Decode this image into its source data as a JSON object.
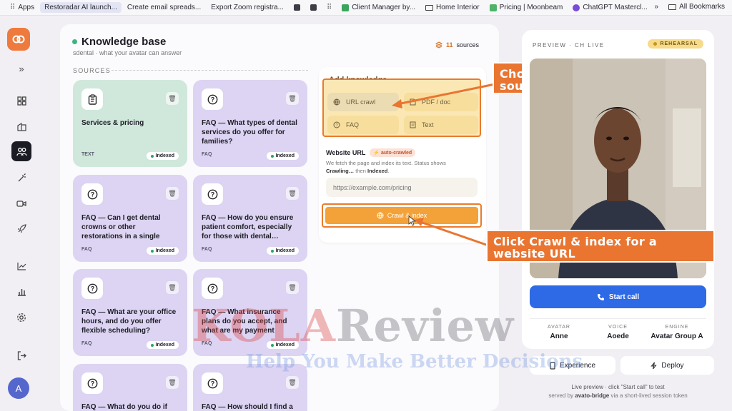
{
  "bookmarks_bar": {
    "items": [
      {
        "label": "Apps"
      },
      {
        "label": "Restoradar AI launch..."
      },
      {
        "label": "Create email spreads..."
      },
      {
        "label": "Export Zoom registra..."
      },
      {
        "label": "Client Manager by..."
      },
      {
        "label": "Home Interior"
      },
      {
        "label": "Pricing | Moonbeam"
      },
      {
        "label": "ChatGPT Mastercl..."
      }
    ],
    "overflow": "»",
    "all_bookmarks": "All Bookmarks"
  },
  "header": {
    "title": "Knowledge base",
    "subtitle": "sdental · what your avatar can answer",
    "sources_count": "11",
    "sources_label": "sources"
  },
  "sources_section_label": "SOURCES",
  "cards": [
    {
      "title": "Services & pricing",
      "type": "TEXT",
      "status": "Indexed"
    },
    {
      "title": "FAQ — What types of dental services do you offer for families?",
      "type": "FAQ",
      "status": "Indexed"
    },
    {
      "title": "FAQ — Can I get dental crowns or other restorations in a single visit?",
      "type": "FAQ",
      "status": "Indexed"
    },
    {
      "title": "FAQ — How do you ensure patient comfort, especially for those with dental…",
      "type": "FAQ",
      "status": "Indexed"
    },
    {
      "title": "FAQ — What are your office hours, and do you offer flexible scheduling?",
      "type": "FAQ",
      "status": "Indexed"
    },
    {
      "title": "FAQ — What insurance plans do you accept, and what are my payment options?",
      "type": "FAQ",
      "status": "Indexed"
    },
    {
      "title": "FAQ — What do you do if you",
      "type": "",
      "status": ""
    },
    {
      "title": "FAQ — How should I find a",
      "type": "",
      "status": ""
    }
  ],
  "add_knowledge": {
    "title": "Add knowledge",
    "options": [
      "URL crawl",
      "PDF / doc",
      "FAQ",
      "Text"
    ],
    "url_label": "Website URL",
    "url_tag": "auto-crawled",
    "help_text": "We fetch the page and index its text. Status shows",
    "help_crawling": "Crawling…",
    "help_then": "then",
    "help_indexed": "Indexed",
    "help_end": ".",
    "url_placeholder": "https://example.com/pricing",
    "crawl_button": "Crawl & index"
  },
  "callouts": {
    "choose_source": "Choose a knowledge source",
    "click_crawl": "Click Crawl & index for a website URL"
  },
  "preview": {
    "header": "PREVIEW · CH LIVE",
    "badge": "REHEARSAL",
    "start_call": "Start call",
    "meta": [
      {
        "key": "AVATAR",
        "value": "Anne"
      },
      {
        "key": "VOICE",
        "value": "Aoede"
      },
      {
        "key": "ENGINE",
        "value": "Avatar Group A"
      }
    ],
    "experience_button": "Experience",
    "deploy_button": "Deploy",
    "footer1": "Live preview · click \"Start call\" to test",
    "footer2_pre": "served by",
    "footer2_bold": "avato-bridge",
    "footer2_post": "via a short-lived session token"
  },
  "user_avatar_initial": "A",
  "watermark": {
    "red": "KOLA",
    "gray": "Review",
    "tagline": "Help You Make Better Decisions"
  },
  "colors": {
    "accent_orange": "#e97531",
    "primary_blue": "#2e6ae6",
    "faq_card": "#dcd4f2",
    "text_card": "#cfe8db",
    "indexed_green": "#2fa06a"
  }
}
